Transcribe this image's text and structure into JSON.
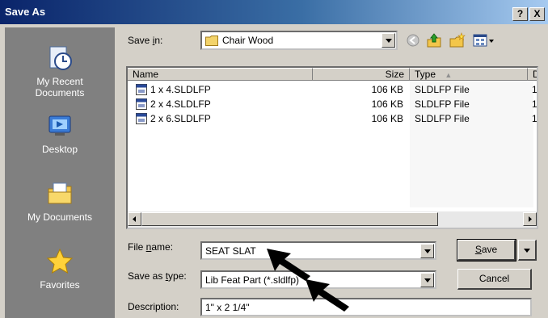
{
  "window": {
    "title": "Save As",
    "help_label": "?",
    "close_label": "X"
  },
  "places": [
    {
      "label": "My Recent Documents",
      "icon": "recent-documents-icon"
    },
    {
      "label": "Desktop",
      "icon": "desktop-icon"
    },
    {
      "label": "My Documents",
      "icon": "my-documents-icon"
    },
    {
      "label": "Favorites",
      "icon": "favorites-icon"
    }
  ],
  "save_in": {
    "label_pre": "Save ",
    "label_ul": "i",
    "label_post": "n:",
    "value": "Chair Wood"
  },
  "toolbar": {
    "back_icon": "back-icon",
    "up_icon": "up-folder-icon",
    "new_folder_icon": "new-folder-icon",
    "views_icon": "views-menu-icon"
  },
  "file_list": {
    "columns": [
      "Name",
      "Size",
      "Type",
      "D"
    ],
    "sort_indicator": "▲",
    "rows": [
      {
        "name": "1 x 4.SLDLFP",
        "size": "106 KB",
        "type": "SLDLFP File",
        "extra": "1"
      },
      {
        "name": "2 x 4.SLDLFP",
        "size": "106 KB",
        "type": "SLDLFP File",
        "extra": "1"
      },
      {
        "name": "2 x 6.SLDLFP",
        "size": "106 KB",
        "type": "SLDLFP File",
        "extra": "1"
      }
    ]
  },
  "file_name": {
    "label_pre": "File ",
    "label_ul": "n",
    "label_post": "ame:",
    "value": "SEAT SLAT"
  },
  "save_as_type": {
    "label_pre": "Save as ",
    "label_ul": "t",
    "label_post": "ype:",
    "value": "Lib Feat Part (*.sldlfp)"
  },
  "description": {
    "label": "Description:",
    "value": "1\" x 2 1/4\""
  },
  "buttons": {
    "save_ul": "S",
    "save_post": "ave",
    "cancel": "Cancel"
  },
  "colors": {
    "title_bar": "#0a246a",
    "places_bar": "#808080",
    "dialog_bg": "#d4d0c8"
  }
}
